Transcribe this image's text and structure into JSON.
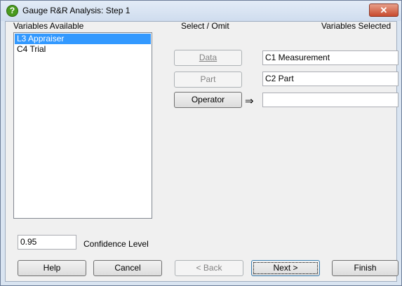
{
  "window": {
    "title": "Gauge R&R Analysis: Step 1",
    "close_glyph": "✕"
  },
  "left": {
    "header": "Variables Available",
    "items": [
      "L3 Appraiser",
      "C4 Trial"
    ],
    "selected_index": 0
  },
  "middle": {
    "header": "Select / Omit",
    "buttons": [
      {
        "label": "Data",
        "enabled": false
      },
      {
        "label": "Part",
        "enabled": false
      },
      {
        "label": "Operator",
        "enabled": true
      }
    ],
    "arrow_glyph": "⇒"
  },
  "right": {
    "header": "Variables Selected",
    "fields": [
      "C1 Measurement",
      "C2 Part",
      ""
    ]
  },
  "confidence": {
    "value": "0.95",
    "label": "Confidence Level"
  },
  "footer": {
    "help": "Help",
    "cancel": "Cancel",
    "back": "< Back",
    "next": "Next >",
    "finish": "Finish"
  }
}
